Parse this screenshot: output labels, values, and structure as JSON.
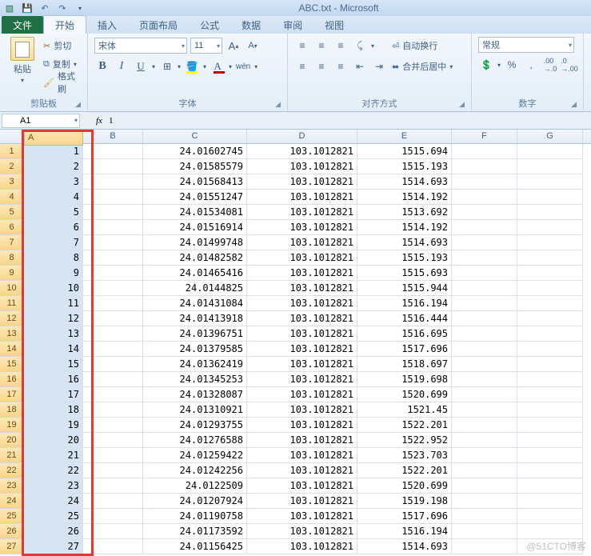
{
  "title": "ABC.txt - Microsoft",
  "tabs": {
    "file": "文件",
    "home": "开始",
    "insert": "插入",
    "layout": "页面布局",
    "formula": "公式",
    "data": "数据",
    "review": "审阅",
    "view": "视图"
  },
  "ribbon": {
    "clipboard": {
      "label": "剪贴板",
      "paste": "粘贴",
      "cut": "剪切",
      "copy": "复制",
      "format": "格式刷"
    },
    "font": {
      "label": "字体",
      "name": "宋体",
      "size": "11",
      "bold": "B",
      "italic": "I",
      "underline": "U"
    },
    "align": {
      "label": "对齐方式",
      "wrap": "自动换行",
      "merge": "合并后居中"
    },
    "number": {
      "label": "数字",
      "format": "常规"
    }
  },
  "namebox": "A1",
  "fx_value": "1",
  "cols": [
    "A",
    "B",
    "C",
    "D",
    "E",
    "F",
    "G"
  ],
  "rows": [
    {
      "n": 1,
      "a": "1",
      "c": "24.01602745",
      "d": "103.1012821",
      "e": "1515.694"
    },
    {
      "n": 2,
      "a": "2",
      "c": "24.01585579",
      "d": "103.1012821",
      "e": "1515.193"
    },
    {
      "n": 3,
      "a": "3",
      "c": "24.01568413",
      "d": "103.1012821",
      "e": "1514.693"
    },
    {
      "n": 4,
      "a": "4",
      "c": "24.01551247",
      "d": "103.1012821",
      "e": "1514.192"
    },
    {
      "n": 5,
      "a": "5",
      "c": "24.01534081",
      "d": "103.1012821",
      "e": "1513.692"
    },
    {
      "n": 6,
      "a": "6",
      "c": "24.01516914",
      "d": "103.1012821",
      "e": "1514.192"
    },
    {
      "n": 7,
      "a": "7",
      "c": "24.01499748",
      "d": "103.1012821",
      "e": "1514.693"
    },
    {
      "n": 8,
      "a": "8",
      "c": "24.01482582",
      "d": "103.1012821",
      "e": "1515.193"
    },
    {
      "n": 9,
      "a": "9",
      "c": "24.01465416",
      "d": "103.1012821",
      "e": "1515.693"
    },
    {
      "n": 10,
      "a": "10",
      "c": "24.0144825",
      "d": "103.1012821",
      "e": "1515.944"
    },
    {
      "n": 11,
      "a": "11",
      "c": "24.01431084",
      "d": "103.1012821",
      "e": "1516.194"
    },
    {
      "n": 12,
      "a": "12",
      "c": "24.01413918",
      "d": "103.1012821",
      "e": "1516.444"
    },
    {
      "n": 13,
      "a": "13",
      "c": "24.01396751",
      "d": "103.1012821",
      "e": "1516.695"
    },
    {
      "n": 14,
      "a": "14",
      "c": "24.01379585",
      "d": "103.1012821",
      "e": "1517.696"
    },
    {
      "n": 15,
      "a": "15",
      "c": "24.01362419",
      "d": "103.1012821",
      "e": "1518.697"
    },
    {
      "n": 16,
      "a": "16",
      "c": "24.01345253",
      "d": "103.1012821",
      "e": "1519.698"
    },
    {
      "n": 17,
      "a": "17",
      "c": "24.01328087",
      "d": "103.1012821",
      "e": "1520.699"
    },
    {
      "n": 18,
      "a": "18",
      "c": "24.01310921",
      "d": "103.1012821",
      "e": "1521.45"
    },
    {
      "n": 19,
      "a": "19",
      "c": "24.01293755",
      "d": "103.1012821",
      "e": "1522.201"
    },
    {
      "n": 20,
      "a": "20",
      "c": "24.01276588",
      "d": "103.1012821",
      "e": "1522.952"
    },
    {
      "n": 21,
      "a": "21",
      "c": "24.01259422",
      "d": "103.1012821",
      "e": "1523.703"
    },
    {
      "n": 22,
      "a": "22",
      "c": "24.01242256",
      "d": "103.1012821",
      "e": "1522.201"
    },
    {
      "n": 23,
      "a": "23",
      "c": "24.0122509",
      "d": "103.1012821",
      "e": "1520.699"
    },
    {
      "n": 24,
      "a": "24",
      "c": "24.01207924",
      "d": "103.1012821",
      "e": "1519.198"
    },
    {
      "n": 25,
      "a": "25",
      "c": "24.01190758",
      "d": "103.1012821",
      "e": "1517.696"
    },
    {
      "n": 26,
      "a": "26",
      "c": "24.01173592",
      "d": "103.1012821",
      "e": "1516.194"
    },
    {
      "n": 27,
      "a": "27",
      "c": "24.01156425",
      "d": "103.1012821",
      "e": "1514.693"
    }
  ],
  "watermark": "@51CTO博客"
}
